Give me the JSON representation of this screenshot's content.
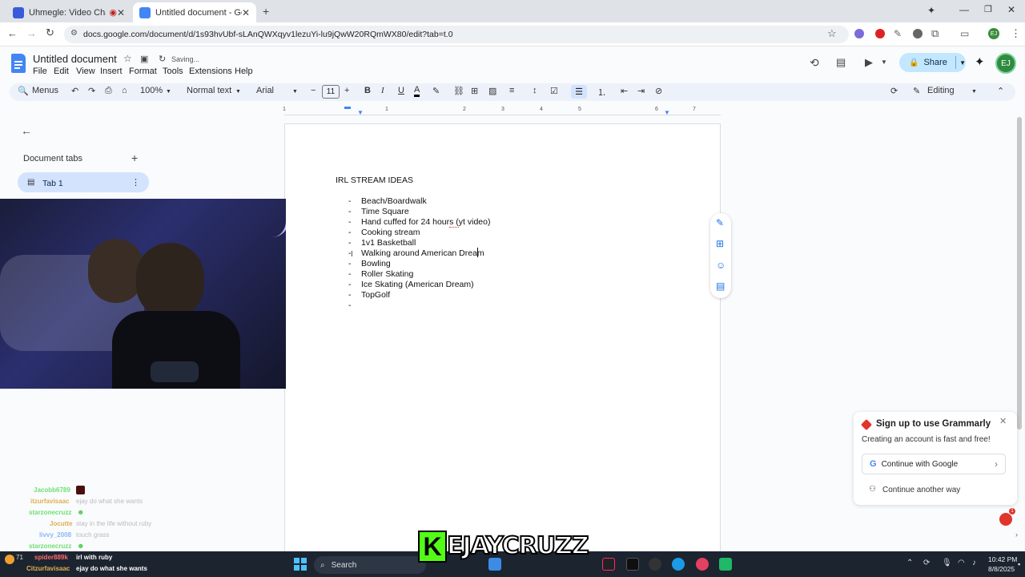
{
  "browser": {
    "tabs": [
      {
        "title": "Uhmegle: Video Chat | Ome",
        "active": false
      },
      {
        "title": "Untitled document - Google D",
        "active": true
      }
    ],
    "url": "docs.google.com/document/d/1s93hvUbf-sLAnQWXqyv1lezuYi-lu9jQwW20RQmWX80/edit?tab=t.0"
  },
  "docs": {
    "title": "Untitled document",
    "status": "Saving...",
    "menus": [
      "File",
      "Edit",
      "View",
      "Insert",
      "Format",
      "Tools",
      "Extensions",
      "Help"
    ],
    "share_label": "Share",
    "avatar": "EJ",
    "toolbar": {
      "search": "Menus",
      "zoom": "100%",
      "style": "Normal text",
      "font": "Arial",
      "size": "11",
      "mode": "Editing"
    },
    "ruler_ticks": [
      "1",
      "1",
      "2",
      "3",
      "4",
      "5",
      "6",
      "7"
    ],
    "sidebar": {
      "heading": "Document tabs",
      "tab": "Tab 1"
    },
    "document": {
      "heading": "IRL STREAM IDEAS",
      "items": [
        "Beach/Boardwalk",
        "Time Square",
        "Hand cuffed for 24 hours (yt video)",
        "Cooking stream",
        "1v1 Basketball",
        "Walking around American Dream",
        "Bowling",
        "Roller Skating",
        "Ice Skating (American Dream)",
        "TopGolf",
        ""
      ]
    }
  },
  "grammarly": {
    "title": "Sign up to use Grammarly",
    "subtitle": "Creating an account is fast and free!",
    "google_btn": "Continue with Google",
    "other_btn": "Continue another way",
    "badge": "1"
  },
  "stream_chat": [
    {
      "user": "Jacobb6789",
      "msg": ""
    },
    {
      "user": "itzurfavisaac",
      "msg": "ejay do what she wants"
    },
    {
      "user": "starzonecruzz",
      "msg": ""
    },
    {
      "user": "Jocutte",
      "msg": "stay in the life without ruby"
    },
    {
      "user": "livvy_2008",
      "msg": "touch grass"
    },
    {
      "user": "starzonecruzz",
      "msg": ""
    },
    {
      "user": "spider889k",
      "msg": "irl with ruby"
    },
    {
      "user": "Citzurfavisaac",
      "msg": "ejay do what she wants"
    }
  ],
  "overlay": {
    "channel_logo": "K",
    "channel_name": "EJAYCRUZZ",
    "viewers": "71"
  },
  "taskbar": {
    "search": "Search",
    "time": "10:42 PM",
    "date": "8/8/2025"
  },
  "colors": {
    "docs_blue": "#4285f4",
    "share_bg": "#c2e7ff",
    "toolbar_bg": "#edf2fa",
    "kick_green": "#53fc18",
    "grammarly_red": "#e0352b"
  }
}
